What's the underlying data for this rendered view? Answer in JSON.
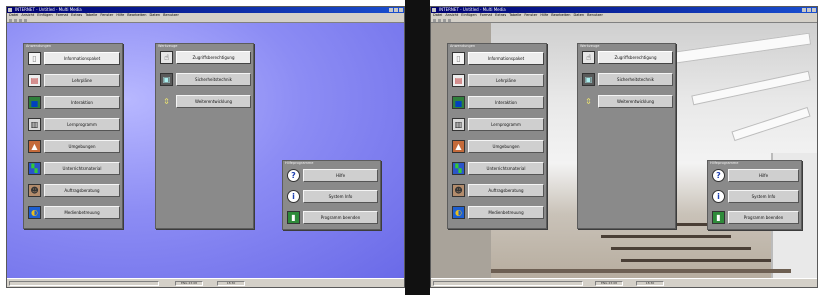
{
  "left_screenshot": {
    "title": "INTERNET - Untitled - Multi Media",
    "menu": [
      "Datei",
      "Ansicht",
      "Einfügen",
      "Format",
      "Extras",
      "Tabelle",
      "Fenster",
      "Hilfe",
      "Bearbeiten",
      "Daten",
      "Benutzer"
    ],
    "status": [
      "",
      "ENG 23:08",
      "18:30"
    ],
    "panel_main": {
      "title": "Anwendungen",
      "items": [
        {
          "label": "Informationspaket",
          "icon": "document-icon"
        },
        {
          "label": "Lehrpläne",
          "icon": "notepad-icon"
        },
        {
          "label": "Interaktion",
          "icon": "landscape-icon"
        },
        {
          "label": "Lernprogramm",
          "icon": "book-icon"
        },
        {
          "label": "Umgebungen",
          "icon": "house-icon"
        },
        {
          "label": "Unterrichtsmaterial",
          "icon": "chart-icon"
        },
        {
          "label": "Auftragsberatung",
          "icon": "people-icon"
        },
        {
          "label": "Medienbetreuung",
          "icon": "globe-icon"
        }
      ]
    },
    "panel_tools": {
      "title": "Werkzeuge",
      "items": [
        {
          "label": "Zugriffsberechtigung",
          "icon": "hand-icon"
        },
        {
          "label": "Sicherheitstechnik",
          "icon": "monitor-icon"
        },
        {
          "label": "Weiterentwicklung",
          "icon": "arrows-icon"
        }
      ]
    },
    "panel_help": {
      "title": "Hilfeprogramme",
      "items": [
        {
          "label": "Hilfe",
          "icon": "help-icon"
        },
        {
          "label": "System Info",
          "icon": "info-icon"
        },
        {
          "label": "Programm beenden",
          "icon": "exit-icon"
        }
      ]
    }
  },
  "right_screenshot": {
    "title": "INTERNET - Untitled - Multi Media",
    "menu": [
      "Datei",
      "Ansicht",
      "Einfügen",
      "Format",
      "Extras",
      "Tabelle",
      "Fenster",
      "Hilfe",
      "Bearbeiten",
      "Daten",
      "Benutzer"
    ],
    "status": [
      "",
      "ENG 23:08",
      "18:30"
    ],
    "panel_main": {
      "title": "Anwendungen",
      "items": [
        {
          "label": "Informationspaket",
          "icon": "document-icon"
        },
        {
          "label": "Lehrpläne",
          "icon": "notepad-icon"
        },
        {
          "label": "Interaktion",
          "icon": "landscape-icon"
        },
        {
          "label": "Lernprogramm",
          "icon": "book-icon"
        },
        {
          "label": "Umgebungen",
          "icon": "house-icon"
        },
        {
          "label": "Unterrichtsmaterial",
          "icon": "chart-icon"
        },
        {
          "label": "Auftragsberatung",
          "icon": "people-icon"
        },
        {
          "label": "Medienbetreuung",
          "icon": "globe-icon"
        }
      ]
    },
    "panel_tools": {
      "title": "Werkzeuge",
      "items": [
        {
          "label": "Zugriffsberechtigung",
          "icon": "hand-icon"
        },
        {
          "label": "Sicherheitstechnik",
          "icon": "monitor-icon"
        },
        {
          "label": "Weiterentwicklung",
          "icon": "arrows-icon"
        }
      ]
    },
    "panel_help": {
      "title": "Hilfeprogramme",
      "items": [
        {
          "label": "Hilfe",
          "icon": "help-icon"
        },
        {
          "label": "System Info",
          "icon": "info-icon"
        },
        {
          "label": "Programm beenden",
          "icon": "exit-icon"
        }
      ]
    }
  },
  "colors": {
    "desktop_blue": "#8c8cf4",
    "panel_gray": "#8a8a8a",
    "button_face": "#cfcfcf",
    "titlebar_blue": "#00006e"
  }
}
